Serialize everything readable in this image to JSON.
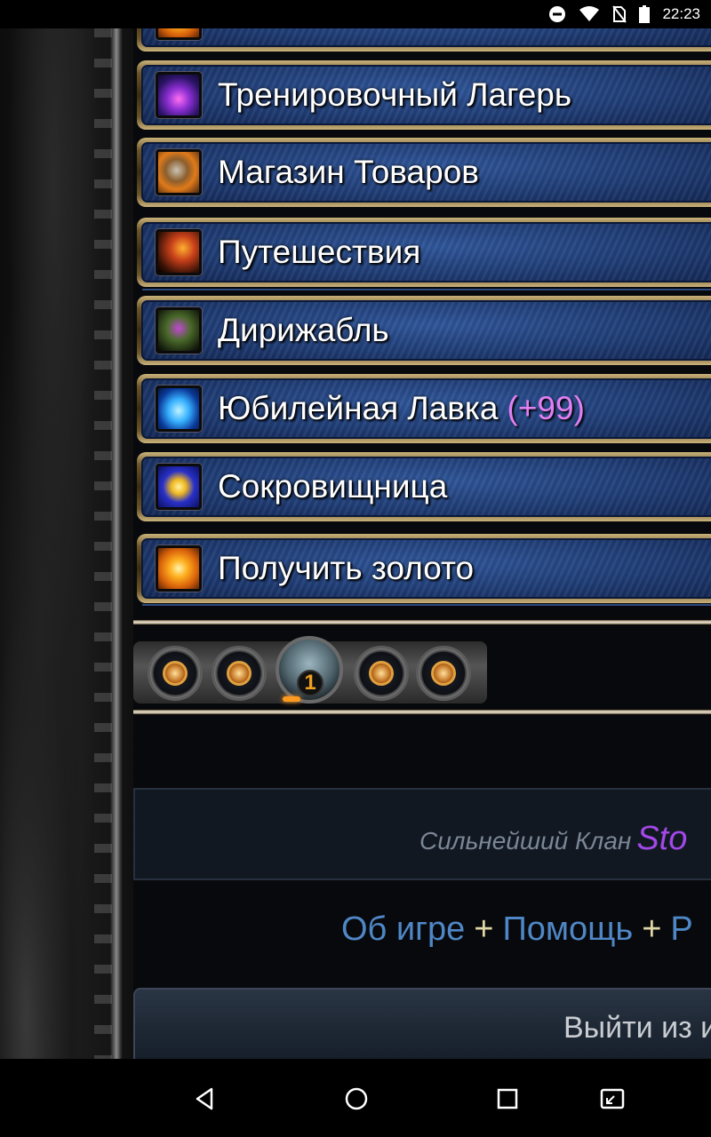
{
  "status_bar": {
    "time": "22:23",
    "icons": [
      "do-not-disturb-icon",
      "wifi-icon",
      "no-sim-icon",
      "battery-icon"
    ]
  },
  "menu": {
    "items": [
      {
        "label": "Тренировочный Лагерь",
        "icon": "training-camp-icon"
      },
      {
        "label": "Магазин Товаров",
        "icon": "goods-shop-icon"
      },
      {
        "label": "Путешествия",
        "icon": "travel-icon"
      },
      {
        "label": "Дирижабль",
        "icon": "airship-icon"
      },
      {
        "label": "Юбилейная Лавка",
        "badge": "(+99)",
        "icon": "jubilee-shop-icon"
      },
      {
        "label": "Сокровищница",
        "icon": "treasury-icon"
      },
      {
        "label": "Получить золото",
        "icon": "gold-icon"
      }
    ]
  },
  "emblems": {
    "active_count": "1",
    "icons": [
      "compass-emblem-icon",
      "castle-emblem-icon",
      "portrait-emblem-icon",
      "shield-emblem-icon",
      "armor-emblem-icon"
    ]
  },
  "clan": {
    "label": "Сильнейший Клан",
    "name": "Sto"
  },
  "footer": {
    "about": "Об игре",
    "help": "Помощь",
    "plus": "+",
    "third": "Р"
  },
  "logout": {
    "label": "Выйти из и"
  },
  "colors": {
    "badge": "#e27ff2",
    "clan_name": "#a248e8",
    "link": "#4f87c6",
    "menu_blue": "#1f3c74",
    "frame_gold": "#c9b27a"
  }
}
